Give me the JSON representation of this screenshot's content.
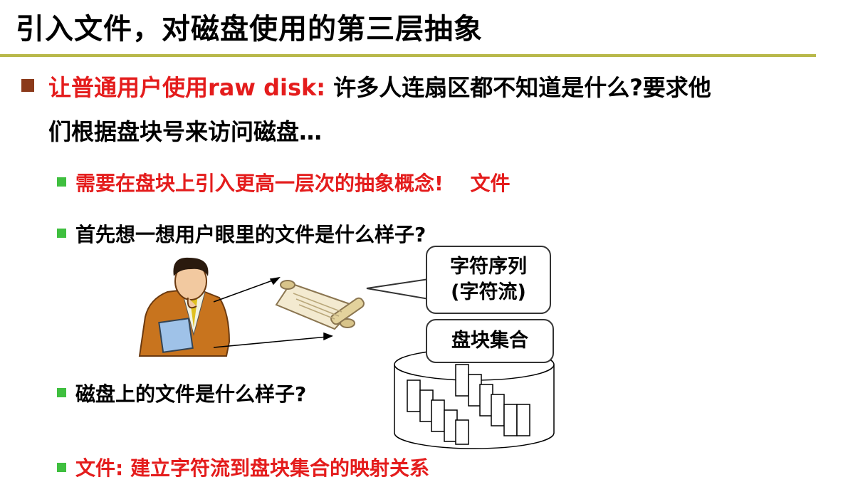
{
  "slide": {
    "title": "引入文件，对磁盘使用的第三层抽象",
    "bullet1": {
      "prefix": "让普通用户使用raw disk:",
      "line1_rest": "许多人连扇区都不知道是什么?要求他",
      "line2": "们根据盘块号来访问磁盘…"
    },
    "sub1": {
      "text": "需要在盘块上引入更高一层次的抽象概念!",
      "keyword": "文件"
    },
    "sub2": {
      "text": "首先想一想用户眼里的文件是什么样子?"
    },
    "sub3": {
      "text": "磁盘上的文件是什么样子?"
    },
    "sub4": {
      "text": "文件: 建立字符流到盘块集合的映射关系"
    },
    "callout_chars": {
      "line1": "字符序列",
      "line2": "(字符流)"
    },
    "callout_blocks": {
      "text": "盘块集合"
    }
  },
  "colors": {
    "red": "#e41c1c",
    "rule": "#b8b84a",
    "main_bullet": "#8b3a1a",
    "sub_bullet": "#3fbf3f"
  }
}
